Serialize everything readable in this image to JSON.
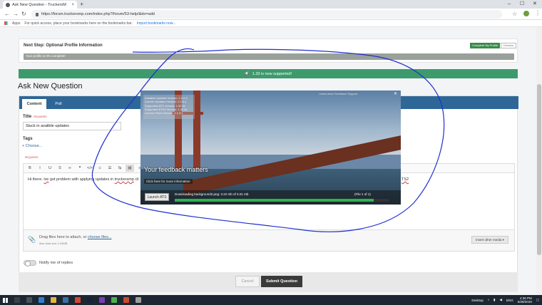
{
  "browser": {
    "tab_title": "Ask New Question - TruckersM",
    "url": "https://forum.truckersmp.com/index.php?/forum/53-help/&do=add",
    "bookmarks_apps": "Apps",
    "bookmarks_hint": "For quick access, place your bookmarks here on the bookmarks bar.",
    "bookmarks_import": "Import bookmarks now..."
  },
  "next_step": {
    "title": "Next Step: Optional Profile Information",
    "complete_label": "Complete My Profile",
    "dismiss_label": "Dismiss",
    "progress_text": "Your profile is 0% complete!"
  },
  "announcement": "1.33 is now supported!",
  "page_title": "Ask New Question",
  "tabs": {
    "content": "Content",
    "poll": "Poll"
  },
  "form": {
    "title_label": "Title",
    "required": "REQUIRED",
    "title_value": "Stuck in avalible updates",
    "tags_label": "Tags",
    "tags_choose": "Choose...",
    "body_text_1": "Hi there. ",
    "body_text_2": "ive",
    "body_text_3": " got problem with applying updates in ",
    "body_text_4": "truckersmp",
    "body_text_5": " cli",
    "body_ts2": "TS2",
    "attach_text": "Drag files here to attach, or ",
    "choose_files": "choose files...",
    "max_size": "Max total size 0.49MB",
    "insert_media": "Insert other media ▾",
    "notify": "Notify me of replies",
    "cancel": "Cancel",
    "submit": "Submit Question"
  },
  "toolbar_buttons": [
    "B",
    "I",
    "U",
    "S",
    "∞",
    "❝",
    "</>",
    "☺",
    "☰",
    "⇆",
    "▤",
    "≡"
  ],
  "overlay": {
    "info_lines": [
      "Installed Updates Version: 1.0.0.4",
      "Current Updates Version: 1.0.0.4",
      "Supported ATS Version: 1.32.5s",
      "Supported ETS2 Version: 1.32.4s",
      "Current Patch Version: 1.1.3.1"
    ],
    "links": "Useful links   Feedback   Support",
    "feedback_title": "Your feedback matters",
    "more_info": "Click here for more information",
    "launch_label": "Launch ATS",
    "download_text": "Downloading background2.png: 3.22 mb of 3.01 mb",
    "file_count": "(File 1 of 1)",
    "progress": 0.93
  },
  "taskbar": {
    "desktop_label": "Desktop",
    "lang": "ENG",
    "time": "4:36 PM",
    "date": "6/28/2019"
  },
  "colors": {
    "accent_blue": "#2e6797",
    "announce_green": "#3d9a6c",
    "progress_green": "#2fb34c",
    "scribble_blue": "#1f2fd0"
  }
}
